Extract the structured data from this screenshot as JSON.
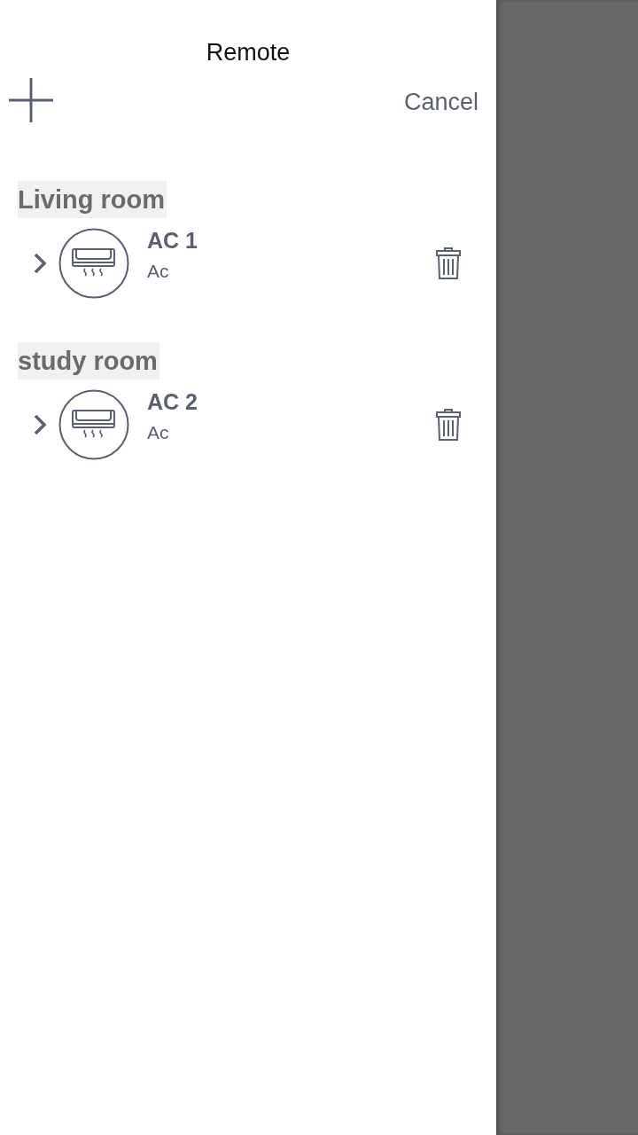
{
  "header": {
    "title": "Remote",
    "cancel": "Cancel"
  },
  "rooms": [
    {
      "name": "Living room",
      "devices": [
        {
          "name": "AC 1",
          "type": "Ac"
        }
      ]
    },
    {
      "name": "study room",
      "devices": [
        {
          "name": "AC 2",
          "type": "Ac"
        }
      ]
    }
  ]
}
